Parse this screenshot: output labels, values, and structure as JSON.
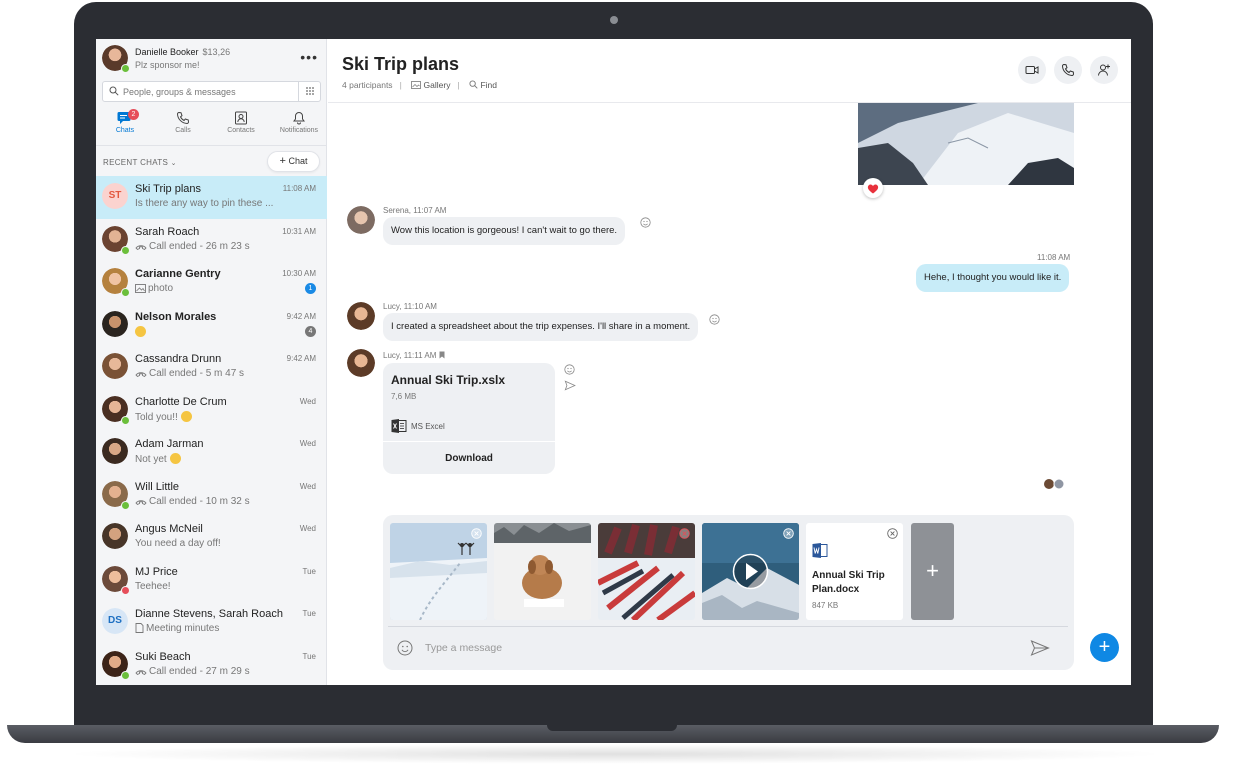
{
  "profile": {
    "name": "Danielle Booker",
    "credit": "$13,26",
    "status": "Plz sponsor me!"
  },
  "search": {
    "placeholder": "People, groups & messages"
  },
  "nav": [
    {
      "label": "Chats",
      "badge": "2"
    },
    {
      "label": "Calls"
    },
    {
      "label": "Contacts"
    },
    {
      "label": "Notifications"
    }
  ],
  "recent": {
    "label": "RECENT CHATS",
    "new_chat": "Chat"
  },
  "chats": [
    {
      "title": "Ski Trip plans",
      "time": "11:08 AM",
      "sub": "Is there any way to pin these ...",
      "initials": "ST"
    },
    {
      "title": "Sarah Roach",
      "time": "10:31 AM",
      "sub": "Call ended - 26 m 23 s"
    },
    {
      "title": "Carianne Gentry",
      "time": "10:30 AM",
      "sub": "photo",
      "unread": "1"
    },
    {
      "title": "Nelson Morales",
      "time": "9:42 AM",
      "sub": "",
      "unread": "4"
    },
    {
      "title": "Cassandra Drunn",
      "time": "9:42 AM",
      "sub": "Call ended - 5 m 47 s"
    },
    {
      "title": "Charlotte De Crum",
      "time": "Wed",
      "sub": "Told you!!"
    },
    {
      "title": "Adam Jarman",
      "time": "Wed",
      "sub": "Not yet"
    },
    {
      "title": "Will Little",
      "time": "Wed",
      "sub": "Call ended - 10 m 32 s"
    },
    {
      "title": "Angus McNeil",
      "time": "Wed",
      "sub": "You need a day off!"
    },
    {
      "title": "MJ Price",
      "time": "Tue",
      "sub": "Teehee!"
    },
    {
      "title": "Dianne Stevens, Sarah Roach",
      "time": "Tue",
      "sub": "Meeting minutes",
      "initials": "DS"
    },
    {
      "title": "Suki Beach",
      "time": "Tue",
      "sub": "Call ended - 27 m 29 s"
    }
  ],
  "conversation": {
    "title": "Ski Trip plans",
    "participants": "4 participants",
    "gallery": "Gallery",
    "find": "Find"
  },
  "messages": [
    {
      "sender": "Serena, 11:07 AM",
      "text": "Wow this location is gorgeous! I can't wait to go there."
    },
    {
      "time": "11:08 AM",
      "text": "Hehe, I thought you would like it."
    },
    {
      "sender": "Lucy, 11:10 AM",
      "text": "I created a spreadsheet about the trip expenses. I'll share in a moment."
    },
    {
      "sender": "Lucy, 11:11 AM"
    }
  ],
  "file": {
    "name": "Annual Ski Trip.xslx",
    "size": "7,6 MB",
    "app": "MS Excel",
    "download": "Download"
  },
  "composer": {
    "doc_name": "Annual Ski Trip Plan.docx",
    "doc_size": "847 KB",
    "placeholder": "Type a message"
  },
  "colors": {
    "accent": "#0078d4",
    "selected": "#c8ecf8",
    "bubble": "#eef0f3",
    "online": "#6bbf3b",
    "unread_blue": "#1a8ae5"
  }
}
